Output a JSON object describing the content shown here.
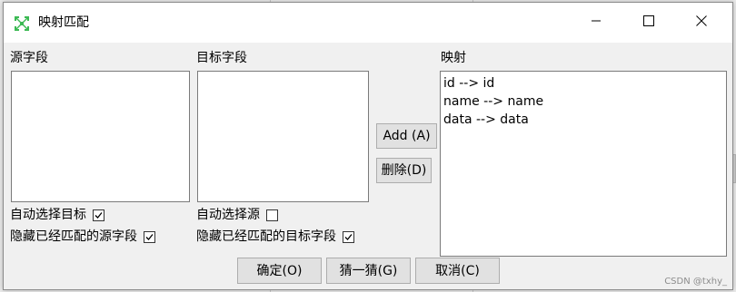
{
  "window": {
    "title": "映射匹配",
    "app_icon": "node-graph-icon",
    "accent_color": "#3cba54"
  },
  "titlebar": {
    "minimize_icon": "minimize-icon",
    "maximize_icon": "maximize-icon",
    "close_icon": "close-icon"
  },
  "source": {
    "label": "源字段",
    "items": [],
    "auto_select_label": "自动选择目标",
    "auto_select_checked": true,
    "hide_matched_label": "隐藏已经匹配的源字段",
    "hide_matched_checked": true
  },
  "target": {
    "label": "目标字段",
    "items": [],
    "auto_select_label": "自动选择源",
    "auto_select_checked": false,
    "hide_matched_label": "隐藏已经匹配的目标字段",
    "hide_matched_checked": true
  },
  "actions": {
    "add_label": "Add (A)",
    "delete_label": "删除(D)"
  },
  "mapping": {
    "label": "映射",
    "items": [
      "id --> id",
      "name --> name",
      "data --> data"
    ]
  },
  "footer": {
    "ok_label": "确定(O)",
    "guess_label": "猜一猜(G)",
    "cancel_label": "取消(C)"
  },
  "watermark": "CSDN @txhy_"
}
